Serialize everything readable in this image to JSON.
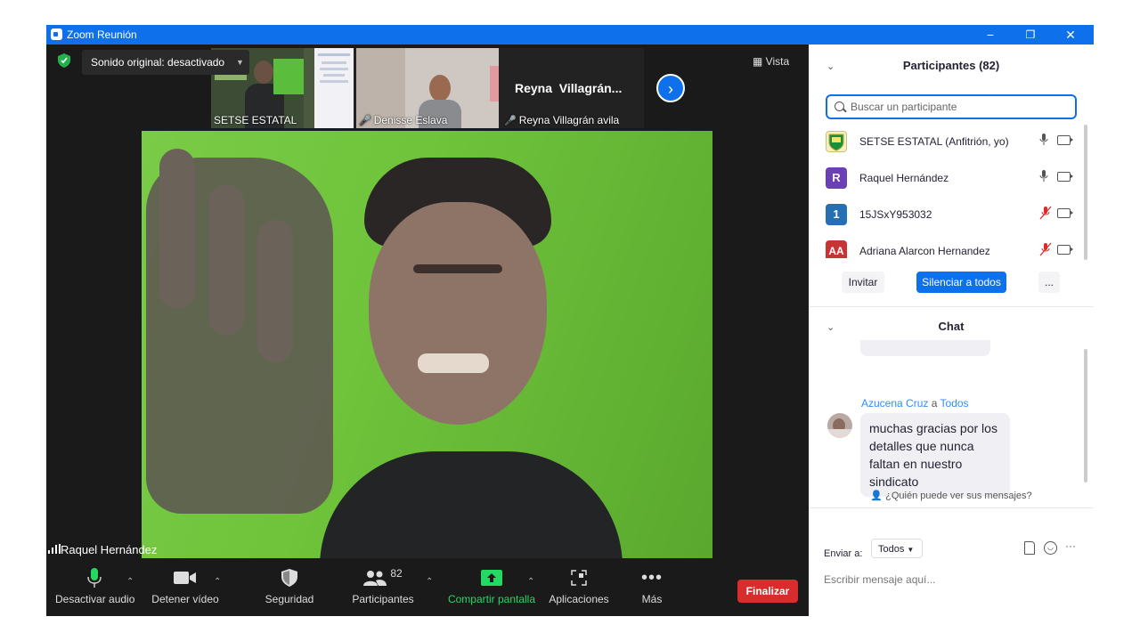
{
  "window": {
    "title": "Zoom Reunión",
    "minimize": "−",
    "restore": "❐",
    "close": "✕"
  },
  "stage": {
    "view_label": "Vista",
    "sound_toggle": "Sonido original: desactivado",
    "thumbnails": [
      {
        "name": "SETSE ESTATAL",
        "muted": false
      },
      {
        "name": "Denisse Eslava",
        "muted": true
      },
      {
        "name": "Reyna Villagrán avila",
        "muted": true
      }
    ],
    "big_name_tile": "Reyna  Villagrán...",
    "active_speaker": "Raquel Hernández"
  },
  "toolbar": {
    "audio": "Desactivar audio",
    "video": "Detener vídeo",
    "security": "Seguridad",
    "participants": "Participantes",
    "participants_count": "82",
    "share": "Compartir pantalla",
    "apps": "Aplicaciones",
    "more": "Más",
    "end": "Finalizar"
  },
  "participants_panel": {
    "header": "Participantes (82)",
    "search_placeholder": "Buscar un participante",
    "rows": [
      {
        "name": "SETSE ESTATAL (Anfitrión, yo)",
        "avatar": "",
        "color": "#ffffff",
        "mic": "on"
      },
      {
        "name": "Raquel Hernández",
        "avatar": "R",
        "color": "#6b3fb5",
        "mic": "on"
      },
      {
        "name": "15JSxY953032",
        "avatar": "1",
        "color": "#2470b3",
        "mic": "muted"
      },
      {
        "name": "Adriana Alarcon Hernandez",
        "avatar": "AA",
        "color": "#c63434",
        "mic": "muted"
      }
    ],
    "invite": "Invitar",
    "mute_all": "Silenciar a todos",
    "more": "..."
  },
  "chat": {
    "header": "Chat",
    "sender": "Azucena Cruz",
    "to_word": "a",
    "recipient": "Todos",
    "message": "muchas gracias por los detalles que nunca faltan en nuestro sindicato",
    "who_can_see": "¿Quién puede ver sus mensajes?",
    "send_to_label": "Enviar a:",
    "send_to_value": "Todos",
    "composer_placeholder": "Escribir mensaje aquí..."
  }
}
